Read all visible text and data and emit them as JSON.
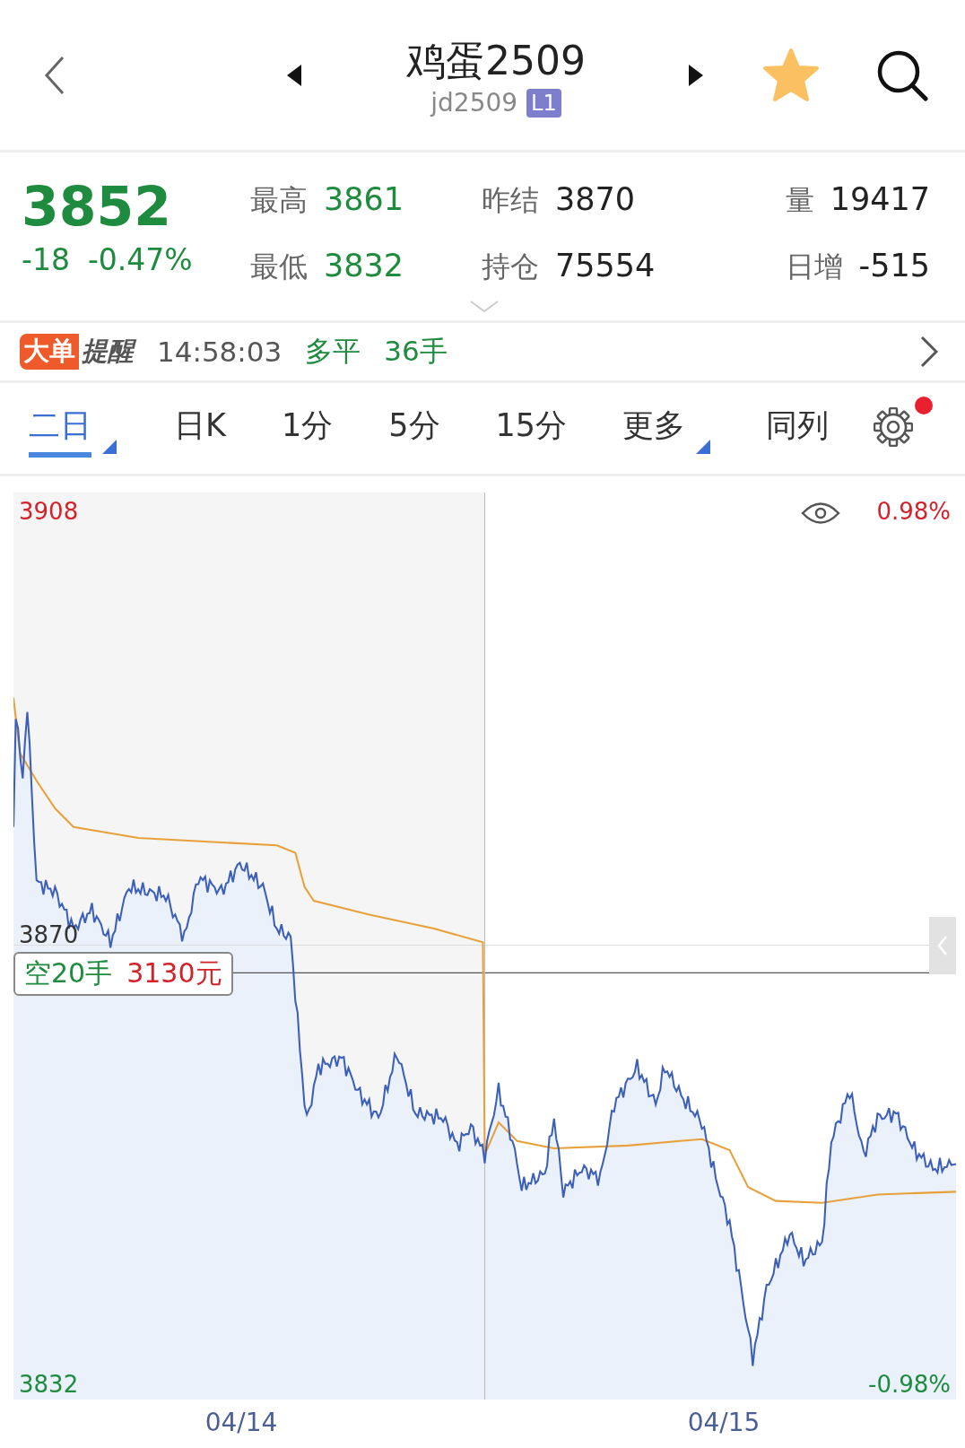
{
  "header": {
    "title": "鸡蛋2509",
    "code": "jd2509",
    "level_badge": "L1",
    "favorite": true
  },
  "quote": {
    "price": "3852",
    "change": "-18",
    "change_pct": "-0.47%",
    "stats": [
      {
        "label": "最高",
        "value": "3861",
        "color": "#1e8b3e"
      },
      {
        "label": "昨结",
        "value": "3870",
        "color": "#222222"
      },
      {
        "label": "量",
        "value": "19417",
        "color": "#222222"
      },
      {
        "label": "最低",
        "value": "3832",
        "color": "#1e8b3e"
      },
      {
        "label": "持仓",
        "value": "75554",
        "color": "#222222"
      },
      {
        "label": "日增",
        "value": "-515",
        "color": "#222222"
      }
    ]
  },
  "alert": {
    "badge_left": "大单",
    "badge_right": "提醒",
    "time": "14:58:03",
    "action": "多平",
    "volume": "36手"
  },
  "tabs": [
    {
      "label": "二日",
      "selected": true,
      "dropdown": true
    },
    {
      "label": "日K",
      "selected": false,
      "dropdown": false
    },
    {
      "label": "1分",
      "selected": false,
      "dropdown": false
    },
    {
      "label": "5分",
      "selected": false,
      "dropdown": false
    },
    {
      "label": "15分",
      "selected": false,
      "dropdown": false
    },
    {
      "label": "更多",
      "selected": false,
      "dropdown": true
    },
    {
      "label": "同列",
      "selected": false,
      "dropdown": false
    }
  ],
  "settings": {
    "notification": true
  },
  "chart": {
    "y_max": "3908",
    "y_ref": "3870",
    "y_min": "3832",
    "pct_max": "0.98%",
    "pct_min": "-0.98%",
    "marker": {
      "side": "空20手",
      "amount": "3130元"
    },
    "dates": [
      "04/14",
      "04/15"
    ]
  }
}
